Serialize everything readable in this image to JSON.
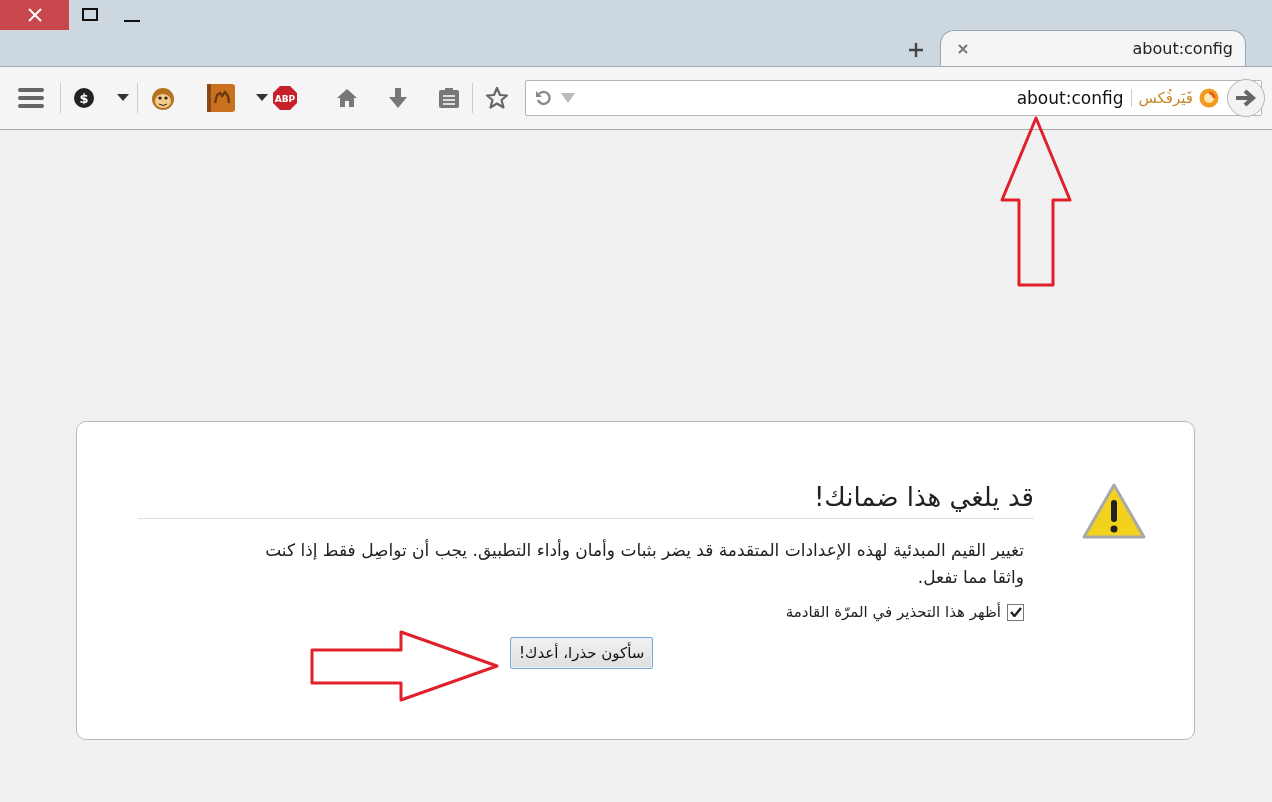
{
  "tabs": [
    {
      "label": "about:config",
      "selected": true
    }
  ],
  "toolbar": {
    "coin_label": "$",
    "adblock_label": "ABP"
  },
  "url_bar": {
    "identity": "فَيَرفُكس",
    "value": "about:config"
  },
  "warning": {
    "title": "قد يلغي هذا ضمانك!",
    "message": "تغيير القيم المبدئية لهذه الإعدادات المتقدمة قد يضر بثبات وأمان وأداء التطبيق. يجب أن تواصِل فقط إذا كنت واثقا مما تفعل.",
    "checkbox": {
      "label": "أظهر هذا التحذير في المرّة القادمة",
      "checked": true
    },
    "button": "سأكون حذرا، أعدك!"
  }
}
